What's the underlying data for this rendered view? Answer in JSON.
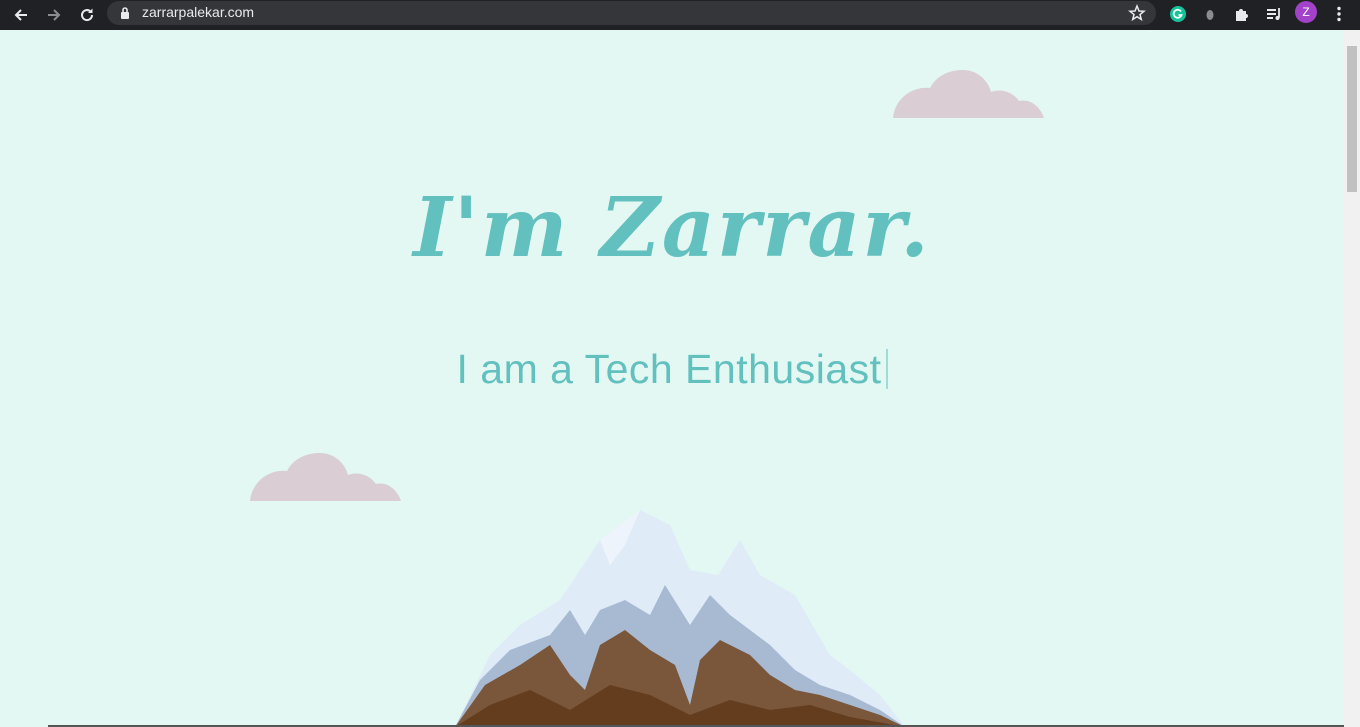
{
  "browser": {
    "url": "zarrarpalekar.com",
    "profile_initial": "Z",
    "colors": {
      "bar": "#202124",
      "omnibox": "#35363a",
      "grammarly": "#15c39a",
      "profile": "#a142c9"
    },
    "icons": [
      "back-icon",
      "forward-icon",
      "reload-icon",
      "lock-icon",
      "star-icon",
      "grammarly-icon",
      "extension-icon",
      "puzzle-icon",
      "media-icon",
      "menu-icon"
    ]
  },
  "hero": {
    "title": "I'm Zarrar.",
    "tagline": "I am a Tech Enthusiast"
  },
  "colors": {
    "background": "#e3f8f2",
    "accent": "#62c0bf",
    "cloud": "#dacdd3",
    "snow": "#e0ebf8",
    "rock": "#7a563a",
    "rock_dark": "#643c1e",
    "shadow": "#a7bad2"
  }
}
